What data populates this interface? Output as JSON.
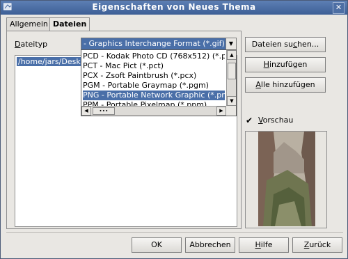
{
  "window": {
    "title": "Eigenschaften von Neues Thema"
  },
  "tabs": [
    {
      "label": "Allgemein"
    },
    {
      "label": "Dateien"
    }
  ],
  "filetype": {
    "label_pre": "D",
    "label_rest": "ateityp",
    "selected": "- Graphics Interchange Format (*.gif)",
    "options": [
      "PCD - Kodak Photo CD (768x512) (*.pcd)",
      "PCT - Mac Pict (*.pct)",
      "PCX - Zsoft Paintbrush (*.pcx)",
      "PGM - Portable Graymap (*.pgm)",
      "PNG - Portable Network Graphic (*.png)",
      "PPM - Portable Pixelmap (*.ppm)"
    ],
    "selected_option_index": 4,
    "hscroll_thumb": "∙∙∙"
  },
  "file_list": {
    "first_item": "/home/jars/Deskt"
  },
  "buttons": {
    "search": {
      "pre": "Dateien su",
      "u": "c",
      "post": "hen..."
    },
    "add": {
      "pre": "",
      "u": "H",
      "post": "inzufügen"
    },
    "add_all": {
      "pre": "",
      "u": "A",
      "post": "lle hinzufügen"
    },
    "ok": "OK",
    "cancel": "Abbrechen",
    "help": {
      "pre": "",
      "u": "H",
      "post": "ilfe"
    },
    "back": {
      "pre": "",
      "u": "Z",
      "post": "urück"
    }
  },
  "preview": {
    "pre": "",
    "u": "V",
    "post": "orschau",
    "checked": true,
    "check_glyph": "✔"
  }
}
